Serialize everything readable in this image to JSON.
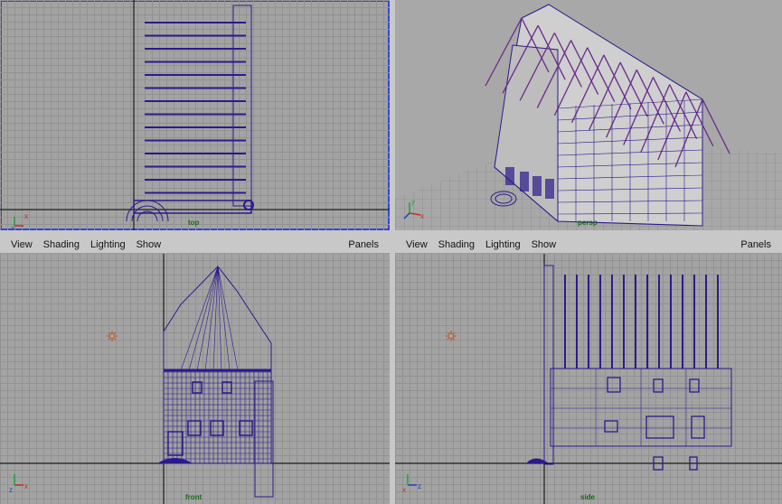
{
  "viewports": {
    "top": {
      "label": "top"
    },
    "persp": {
      "label": "persp"
    },
    "front": {
      "label": "front"
    },
    "side": {
      "label": "side"
    }
  },
  "menu": {
    "view": "View",
    "shading": "Shading",
    "lighting": "Lighting",
    "show": "Show",
    "panels": "Panels"
  },
  "colors": {
    "wireframe": "#2b1a8c",
    "roof_wire": "#6a2a8a",
    "active_border": "#3048d8",
    "label_green": "#1a6b1a"
  }
}
